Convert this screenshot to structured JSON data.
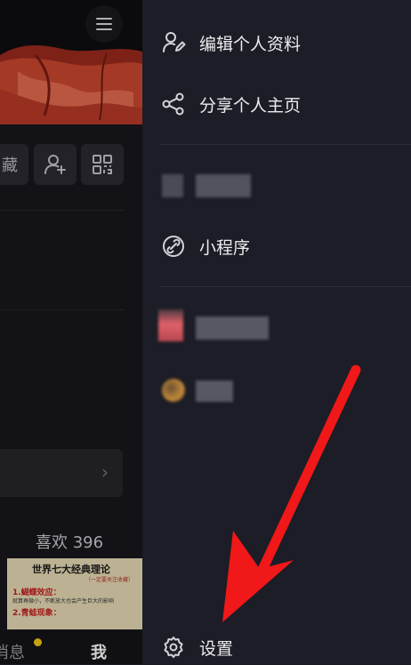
{
  "profile": {
    "collect_label": "藏",
    "likes_label": "喜欢 396",
    "video_thumb": {
      "title": "世界七大经典理论",
      "subtitle": "（一定要关注收藏）",
      "point1": "1.蝴蝶效应：",
      "point1_desc": "就算再微小，不断放大也会产生巨大的影响",
      "point2": "2.青蛙现象："
    }
  },
  "bottom_nav": {
    "messages": "消息",
    "me": "我"
  },
  "drawer": {
    "items": [
      {
        "label": "编辑个人资料",
        "icon": "edit-profile-icon"
      },
      {
        "label": "分享个人主页",
        "icon": "share-icon"
      },
      {
        "label": "小程序",
        "icon": "mini-program-icon"
      },
      {
        "label": "设置",
        "icon": "gear-icon"
      }
    ]
  },
  "colors": {
    "drawer_bg": "#1c1d26",
    "arrow": "#f01818",
    "badge_dot": "#f5c518"
  }
}
